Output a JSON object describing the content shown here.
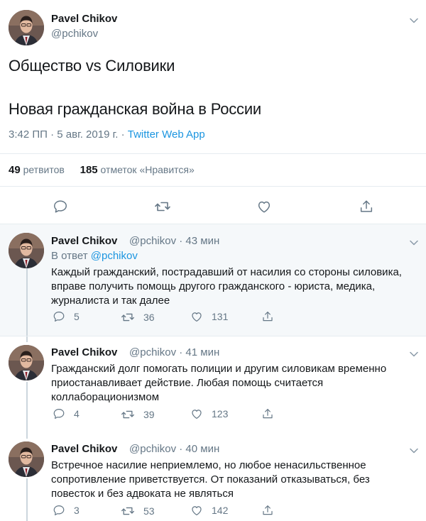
{
  "main_tweet": {
    "name": "Pavel Chikov",
    "handle": "@pchikov",
    "line1": "Общество vs Силовики",
    "line2": "Новая гражданская война в России",
    "timestamp": "3:42 ПП · 5 авг. 2019 г.",
    "separator": " · ",
    "source": "Twitter Web App",
    "retweets_count": "49",
    "retweets_label": "ретвитов",
    "likes_count": "185",
    "likes_label": "отметок «Нравится»"
  },
  "replies": [
    {
      "name": "Pavel Chikov",
      "handle": "@pchikov · 43 мин",
      "in_reply_prefix": "В ответ ",
      "in_reply_handle": "@pchikov",
      "text": "Каждый гражданский, пострадавший от насилия со стороны силовика, вправе получить помощь другого гражданского - юриста, медика, журналиста и так далее",
      "reply_count": "5",
      "retweet_count": "36",
      "like_count": "131"
    },
    {
      "name": "Pavel Chikov",
      "handle": "@pchikov · 41 мин",
      "text": "Гражданский долг помогать полиции и другим силовикам временно приостанавливает действие. Любая помощь считается коллаборационизмом",
      "reply_count": "4",
      "retweet_count": "39",
      "like_count": "123"
    },
    {
      "name": "Pavel Chikov",
      "handle": "@pchikov · 40 мин",
      "text": "Встречное насилие неприемлемо, но любое ненасильственное сопротивление приветствуется. От показаний отказываться, без повесток и без адвоката не являться",
      "reply_count": "3",
      "retweet_count": "53",
      "like_count": "142"
    }
  ],
  "colors": {
    "accent": "#1b95e0",
    "text": "#14171a",
    "muted": "#657786",
    "highlight_bg": "#f5f8fa",
    "divider": "#e6ecf0"
  },
  "icons": [
    "reply-icon",
    "retweet-icon",
    "like-icon",
    "share-icon",
    "chevron-down-icon",
    "avatar"
  ]
}
